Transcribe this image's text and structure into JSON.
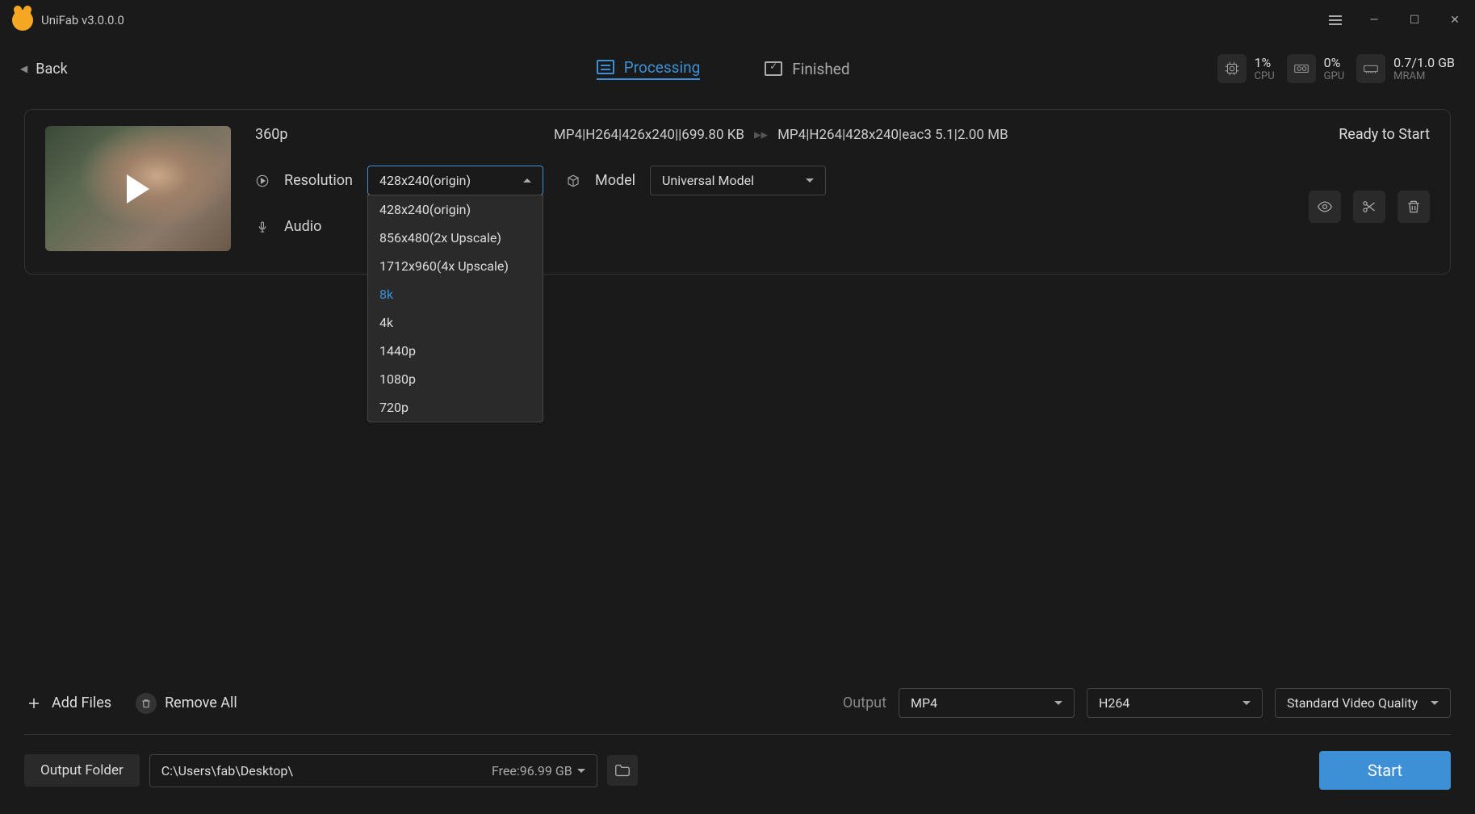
{
  "app": {
    "title": "UniFab v3.0.0.0"
  },
  "toolbar": {
    "back": "Back",
    "tabs": {
      "processing": "Processing",
      "finished": "Finished"
    },
    "stats": {
      "cpu": {
        "value": "1%",
        "label": "CPU"
      },
      "gpu": {
        "value": "0%",
        "label": "GPU"
      },
      "mram": {
        "value": "0.7/1.0 GB",
        "label": "MRAM"
      }
    }
  },
  "task": {
    "name": "360p",
    "source": "MP4|H264|426x240||699.80 KB",
    "target": "MP4|H264|428x240|eac3 5.1|2.00 MB",
    "status": "Ready to Start",
    "resolution_label": "Resolution",
    "resolution_value": "428x240(origin)",
    "resolution_options": [
      "428x240(origin)",
      "856x480(2x Upscale)",
      "1712x960(4x Upscale)",
      "8k",
      "4k",
      "1440p",
      "1080p",
      "720p"
    ],
    "model_label": "Model",
    "model_value": "Universal Model",
    "audio_label": "Audio"
  },
  "bottom": {
    "add_files": "Add Files",
    "remove_all": "Remove All",
    "output_label": "Output",
    "format": "MP4",
    "codec": "H264",
    "quality": "Standard Video Quality",
    "folder_btn": "Output Folder",
    "path": "C:\\Users\\fab\\Desktop\\",
    "free": "Free:96.99 GB",
    "start": "Start"
  }
}
